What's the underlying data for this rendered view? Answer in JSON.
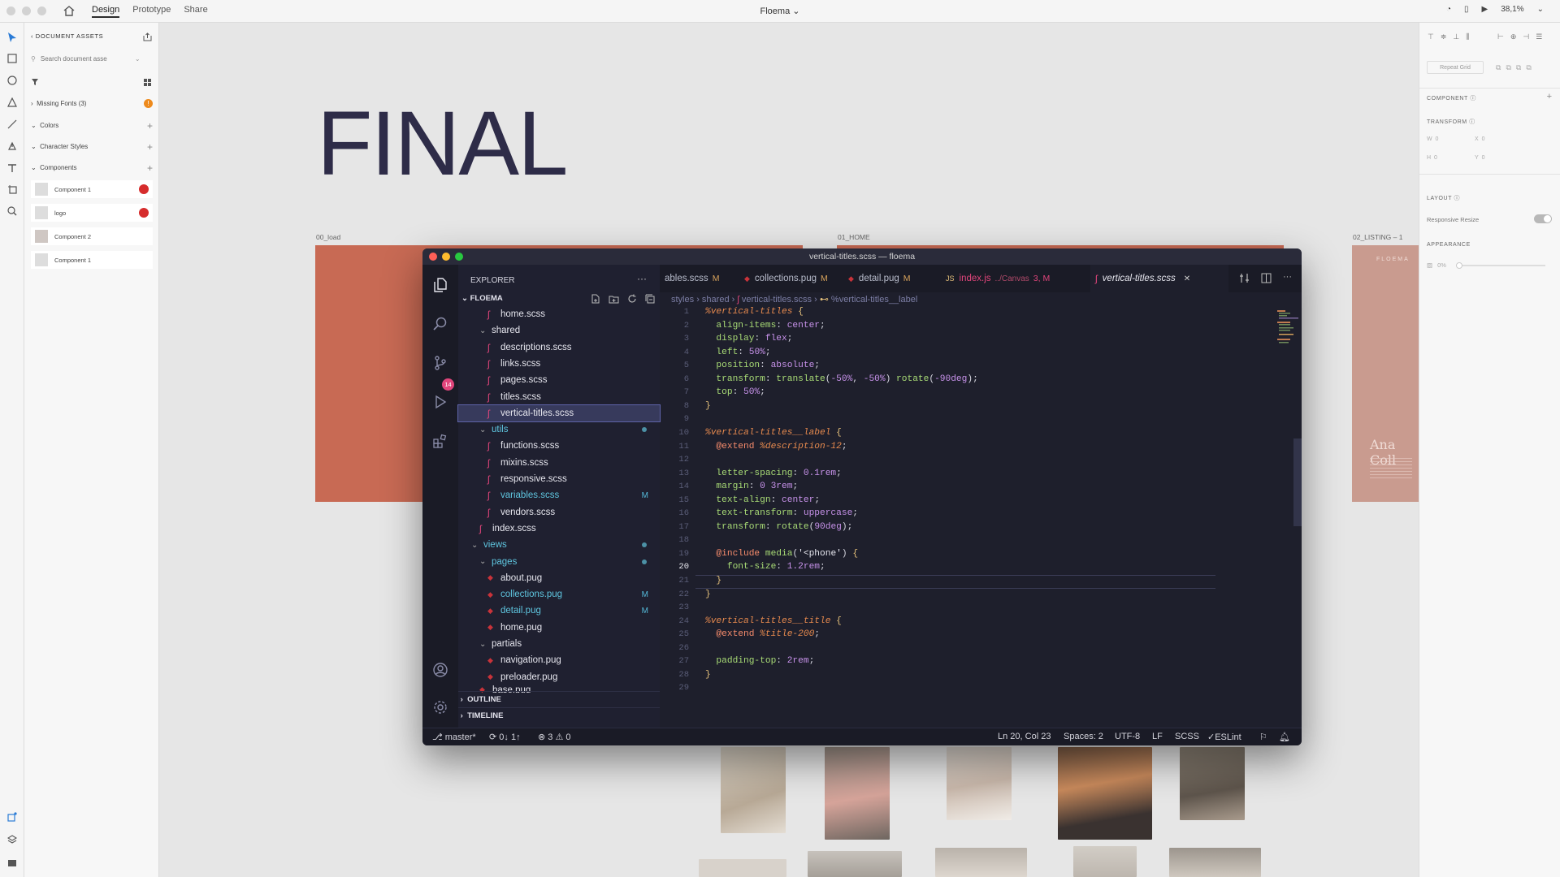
{
  "xd": {
    "modes": [
      "Design",
      "Prototype",
      "Share"
    ],
    "active_mode": "Design",
    "doc_title": "Floema",
    "zoom": "38,1%"
  },
  "assets": {
    "header": "DOCUMENT ASSETS",
    "search_placeholder": "Search document asse",
    "missing_fonts": "Missing Fonts (3)",
    "sections": {
      "colors": "Colors",
      "character_styles": "Character Styles",
      "components": "Components"
    },
    "components": [
      {
        "label": "Component 1",
        "flag": true
      },
      {
        "label": "logo",
        "flag": true
      },
      {
        "label": "Component 2",
        "flag": false
      },
      {
        "label": "Component 1",
        "flag": false
      }
    ]
  },
  "props": {
    "repeat_grid": "Repeat Grid",
    "component": "COMPONENT",
    "transform": "TRANSFORM",
    "w_label": "W",
    "w_value": "0",
    "x_label": "X",
    "x_value": "0",
    "h_label": "H",
    "h_value": "0",
    "y_label": "Y",
    "y_value": "0",
    "layout": "LAYOUT",
    "responsive_resize": "Responsive Resize",
    "appearance": "APPEARANCE",
    "opacity": "0%"
  },
  "canvas": {
    "title": "FINAL",
    "artboards": {
      "load": "00_load",
      "home": "01_HOME",
      "listing": "02_LISTING – 1"
    },
    "listing_brand": "FLOEMA",
    "listing_name": "Ana Coll"
  },
  "vscode": {
    "window_title": "vertical-titles.scss — floema",
    "explorer_title": "EXPLORER",
    "explorer_more": "···",
    "root": "FLOEMA",
    "scm_badge": "14",
    "tree": [
      {
        "label": "home.scss",
        "type": "scss",
        "indent": 3
      },
      {
        "label": "shared",
        "type": "folder",
        "indent": 2
      },
      {
        "label": "descriptions.scss",
        "type": "scss",
        "indent": 3
      },
      {
        "label": "links.scss",
        "type": "scss",
        "indent": 3
      },
      {
        "label": "pages.scss",
        "type": "scss",
        "indent": 3
      },
      {
        "label": "titles.scss",
        "type": "scss",
        "indent": 3
      },
      {
        "label": "vertical-titles.scss",
        "type": "scss",
        "indent": 3,
        "selected": true
      },
      {
        "label": "utils",
        "type": "folder",
        "indent": 2,
        "dot": true,
        "teal": true
      },
      {
        "label": "functions.scss",
        "type": "scss",
        "indent": 3
      },
      {
        "label": "mixins.scss",
        "type": "scss",
        "indent": 3
      },
      {
        "label": "responsive.scss",
        "type": "scss",
        "indent": 3
      },
      {
        "label": "variables.scss",
        "type": "scss",
        "indent": 3,
        "mod": "M",
        "teal": true
      },
      {
        "label": "vendors.scss",
        "type": "scss",
        "indent": 3
      },
      {
        "label": "index.scss",
        "type": "scss",
        "indent": 2
      },
      {
        "label": "views",
        "type": "folder",
        "indent": 1,
        "dot": true,
        "teal": true
      },
      {
        "label": "pages",
        "type": "folder",
        "indent": 2,
        "dot": true,
        "teal": true
      },
      {
        "label": "about.pug",
        "type": "pug",
        "indent": 3
      },
      {
        "label": "collections.pug",
        "type": "pug",
        "indent": 3,
        "mod": "M",
        "teal": true
      },
      {
        "label": "detail.pug",
        "type": "pug",
        "indent": 3,
        "mod": "M",
        "teal": true
      },
      {
        "label": "home.pug",
        "type": "pug",
        "indent": 3
      },
      {
        "label": "partials",
        "type": "folder",
        "indent": 2
      },
      {
        "label": "navigation.pug",
        "type": "pug",
        "indent": 3
      },
      {
        "label": "preloader.pug",
        "type": "pug",
        "indent": 3
      },
      {
        "label": "base.pug",
        "type": "pug",
        "indent": 2
      }
    ],
    "outline": "OUTLINE",
    "timeline": "TIMELINE",
    "tabs": [
      {
        "label": "ables.scss",
        "mod": "M",
        "icon": "none"
      },
      {
        "label": "collections.pug",
        "mod": "M",
        "icon": "pug"
      },
      {
        "label": "detail.pug",
        "mod": "M",
        "icon": "pug"
      },
      {
        "label": "index.js",
        "extra": "../Canvas",
        "mod": "3, M",
        "icon": "js"
      },
      {
        "label": "vertical-titles.scss",
        "mod": "",
        "icon": "scss",
        "active": true
      }
    ],
    "breadcrumb": [
      "styles",
      "shared",
      "vertical-titles.scss",
      "%vertical-titles__label"
    ],
    "current_line": 20,
    "code": [
      [
        [
          "%vertical-titles",
          "sel"
        ],
        [
          " {",
          "brace"
        ]
      ],
      [
        [
          "  align-items",
          "prop"
        ],
        [
          ": ",
          "p"
        ],
        [
          "center",
          "val"
        ],
        [
          ";",
          "p"
        ]
      ],
      [
        [
          "  display",
          "prop"
        ],
        [
          ": ",
          "p"
        ],
        [
          "flex",
          "val"
        ],
        [
          ";",
          "p"
        ]
      ],
      [
        [
          "  left",
          "prop"
        ],
        [
          ": ",
          "p"
        ],
        [
          "50%",
          "num"
        ],
        [
          ";",
          "p"
        ]
      ],
      [
        [
          "  position",
          "prop"
        ],
        [
          ": ",
          "p"
        ],
        [
          "absolute",
          "val"
        ],
        [
          ";",
          "p"
        ]
      ],
      [
        [
          "  transform",
          "prop"
        ],
        [
          ": ",
          "p"
        ],
        [
          "translate",
          "prop"
        ],
        [
          "(",
          "p"
        ],
        [
          "-50%",
          "num"
        ],
        [
          ", ",
          "p"
        ],
        [
          "-50%",
          "num"
        ],
        [
          ") ",
          "p"
        ],
        [
          "rotate",
          "prop"
        ],
        [
          "(",
          "p"
        ],
        [
          "-90deg",
          "num"
        ],
        [
          ");",
          "p"
        ]
      ],
      [
        [
          "  top",
          "prop"
        ],
        [
          ": ",
          "p"
        ],
        [
          "50%",
          "num"
        ],
        [
          ";",
          "p"
        ]
      ],
      [
        [
          "}",
          "brace"
        ]
      ],
      [],
      [
        [
          "%vertical-titles__label",
          "sel"
        ],
        [
          " {",
          "brace"
        ]
      ],
      [
        [
          "  @extend ",
          "at"
        ],
        [
          "%description-12",
          "sel"
        ],
        [
          ";",
          "p"
        ]
      ],
      [],
      [
        [
          "  letter-spacing",
          "prop"
        ],
        [
          ": ",
          "p"
        ],
        [
          "0.1rem",
          "num"
        ],
        [
          ";",
          "p"
        ]
      ],
      [
        [
          "  margin",
          "prop"
        ],
        [
          ": ",
          "p"
        ],
        [
          "0 3rem",
          "num"
        ],
        [
          ";",
          "p"
        ]
      ],
      [
        [
          "  text-align",
          "prop"
        ],
        [
          ": ",
          "p"
        ],
        [
          "center",
          "val"
        ],
        [
          ";",
          "p"
        ]
      ],
      [
        [
          "  text-transform",
          "prop"
        ],
        [
          ": ",
          "p"
        ],
        [
          "uppercase",
          "val"
        ],
        [
          ";",
          "p"
        ]
      ],
      [
        [
          "  transform",
          "prop"
        ],
        [
          ": ",
          "p"
        ],
        [
          "rotate",
          "prop"
        ],
        [
          "(",
          "p"
        ],
        [
          "90deg",
          "num"
        ],
        [
          ");",
          "p"
        ]
      ],
      [],
      [
        [
          "  @include ",
          "at"
        ],
        [
          "media",
          "prop"
        ],
        [
          "(",
          "p"
        ],
        [
          "'<phone'",
          "str"
        ],
        [
          ") ",
          "p"
        ],
        [
          "{",
          "brace"
        ]
      ],
      [
        [
          "    font-size",
          "prop"
        ],
        [
          ": ",
          "p"
        ],
        [
          "1.2rem",
          "num"
        ],
        [
          ";",
          "p"
        ]
      ],
      [
        [
          "  }",
          "brace"
        ]
      ],
      [
        [
          "}",
          "brace"
        ]
      ],
      [],
      [
        [
          "%vertical-titles__title",
          "sel"
        ],
        [
          " {",
          "brace"
        ]
      ],
      [
        [
          "  @extend ",
          "at"
        ],
        [
          "%title-200",
          "sel"
        ],
        [
          ";",
          "p"
        ]
      ],
      [],
      [
        [
          "  padding-top",
          "prop"
        ],
        [
          ": ",
          "p"
        ],
        [
          "2rem",
          "num"
        ],
        [
          ";",
          "p"
        ]
      ],
      [
        [
          "}",
          "brace"
        ]
      ],
      []
    ],
    "status": {
      "branch": "master*",
      "sync": "0↓ 1↑",
      "errors": "3",
      "warnings": "0",
      "position": "Ln 20, Col 23",
      "spaces": "Spaces: 2",
      "encoding": "UTF-8",
      "eol": "LF",
      "language": "SCSS",
      "lint": "ESLint"
    }
  },
  "colors": {
    "accent_red": "#d62c2c",
    "vscode_bg": "#1e1f2c",
    "artboard_terracotta": "#c86a54"
  }
}
